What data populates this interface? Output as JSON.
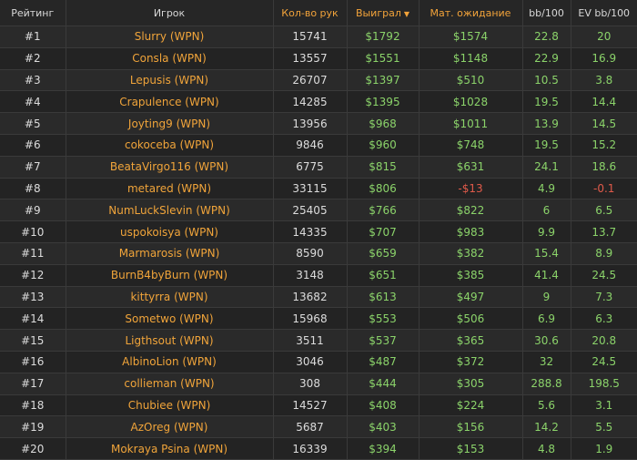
{
  "colors": {
    "accent": "#f2a33a",
    "positive": "#8bd36a",
    "negative": "#e05a4a",
    "text": "#dcdcdc",
    "background": "#232323"
  },
  "header": {
    "rank": "Рейтинг",
    "player": "Игрок",
    "hands": "Кол-во рук",
    "won": "Выиграл",
    "won_sort_icon": "sort-desc-icon",
    "ev": "Мат. ожидание",
    "bb100": "bb/100",
    "evbb100": "EV bb/100"
  },
  "rows": [
    {
      "rank": "#1",
      "player": "Slurry (WPN)",
      "hands": "15741",
      "won": "$1792",
      "ev": "$1574",
      "bb": "22.8",
      "evbb": "20"
    },
    {
      "rank": "#2",
      "player": "Consla (WPN)",
      "hands": "13557",
      "won": "$1551",
      "ev": "$1148",
      "bb": "22.9",
      "evbb": "16.9"
    },
    {
      "rank": "#3",
      "player": "Lepusis (WPN)",
      "hands": "26707",
      "won": "$1397",
      "ev": "$510",
      "bb": "10.5",
      "evbb": "3.8"
    },
    {
      "rank": "#4",
      "player": "Crapulence (WPN)",
      "hands": "14285",
      "won": "$1395",
      "ev": "$1028",
      "bb": "19.5",
      "evbb": "14.4"
    },
    {
      "rank": "#5",
      "player": "Joyting9 (WPN)",
      "hands": "13956",
      "won": "$968",
      "ev": "$1011",
      "bb": "13.9",
      "evbb": "14.5"
    },
    {
      "rank": "#6",
      "player": "cokoceba (WPN)",
      "hands": "9846",
      "won": "$960",
      "ev": "$748",
      "bb": "19.5",
      "evbb": "15.2"
    },
    {
      "rank": "#7",
      "player": "BeataVirgo116 (WPN)",
      "hands": "6775",
      "won": "$815",
      "ev": "$631",
      "bb": "24.1",
      "evbb": "18.6"
    },
    {
      "rank": "#8",
      "player": "metared (WPN)",
      "hands": "33115",
      "won": "$806",
      "ev": "-$13",
      "bb": "4.9",
      "evbb": "-0.1"
    },
    {
      "rank": "#9",
      "player": "NumLuckSlevin (WPN)",
      "hands": "25405",
      "won": "$766",
      "ev": "$822",
      "bb": "6",
      "evbb": "6.5"
    },
    {
      "rank": "#10",
      "player": "uspokoisya (WPN)",
      "hands": "14335",
      "won": "$707",
      "ev": "$983",
      "bb": "9.9",
      "evbb": "13.7"
    },
    {
      "rank": "#11",
      "player": "Marmarosis (WPN)",
      "hands": "8590",
      "won": "$659",
      "ev": "$382",
      "bb": "15.4",
      "evbb": "8.9"
    },
    {
      "rank": "#12",
      "player": "BurnB4byBurn (WPN)",
      "hands": "3148",
      "won": "$651",
      "ev": "$385",
      "bb": "41.4",
      "evbb": "24.5"
    },
    {
      "rank": "#13",
      "player": "kittyrra (WPN)",
      "hands": "13682",
      "won": "$613",
      "ev": "$497",
      "bb": "9",
      "evbb": "7.3"
    },
    {
      "rank": "#14",
      "player": "Sometwo (WPN)",
      "hands": "15968",
      "won": "$553",
      "ev": "$506",
      "bb": "6.9",
      "evbb": "6.3"
    },
    {
      "rank": "#15",
      "player": "Ligthsout (WPN)",
      "hands": "3511",
      "won": "$537",
      "ev": "$365",
      "bb": "30.6",
      "evbb": "20.8"
    },
    {
      "rank": "#16",
      "player": "AlbinoLion (WPN)",
      "hands": "3046",
      "won": "$487",
      "ev": "$372",
      "bb": "32",
      "evbb": "24.5"
    },
    {
      "rank": "#17",
      "player": "collieman (WPN)",
      "hands": "308",
      "won": "$444",
      "ev": "$305",
      "bb": "288.8",
      "evbb": "198.5"
    },
    {
      "rank": "#18",
      "player": "Chubiee (WPN)",
      "hands": "14527",
      "won": "$408",
      "ev": "$224",
      "bb": "5.6",
      "evbb": "3.1"
    },
    {
      "rank": "#19",
      "player": "AzOreg (WPN)",
      "hands": "5687",
      "won": "$403",
      "ev": "$156",
      "bb": "14.2",
      "evbb": "5.5"
    },
    {
      "rank": "#20",
      "player": "Mokraya Psina (WPN)",
      "hands": "16339",
      "won": "$394",
      "ev": "$153",
      "bb": "4.8",
      "evbb": "1.9"
    }
  ]
}
